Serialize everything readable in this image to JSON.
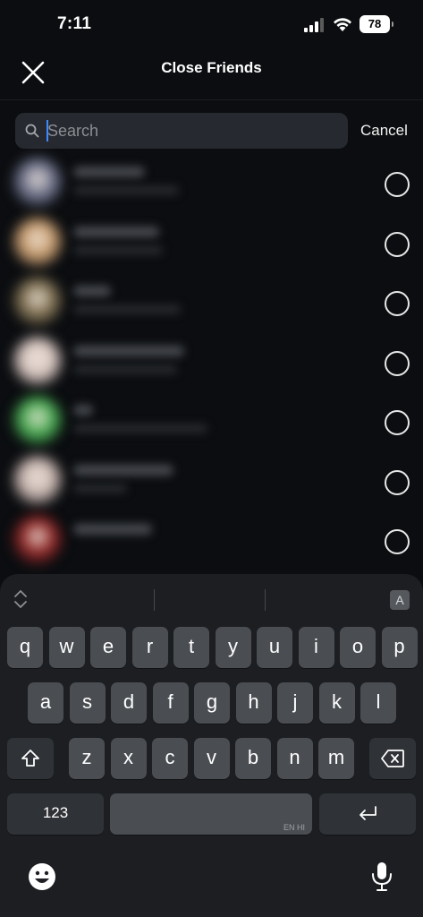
{
  "status": {
    "time": "7:11",
    "battery": "78"
  },
  "header": {
    "title": "Close Friends"
  },
  "search": {
    "placeholder": "Search",
    "cancel_label": "Cancel"
  },
  "friends": [
    {
      "avatar_color": "#6a6f8a",
      "selected": false
    },
    {
      "avatar_color": "#c79a6a",
      "selected": false
    },
    {
      "avatar_color": "#7a6a4a",
      "selected": false
    },
    {
      "avatar_color": "#d8c6c0",
      "selected": false
    },
    {
      "avatar_color": "#3fa84a",
      "selected": false
    },
    {
      "avatar_color": "#c9b6b0",
      "selected": false
    },
    {
      "avatar_color": "#8a1d1d",
      "selected": false
    }
  ],
  "keyboard": {
    "row1": [
      "q",
      "w",
      "e",
      "r",
      "t",
      "y",
      "u",
      "i",
      "o",
      "p"
    ],
    "row2": [
      "a",
      "s",
      "d",
      "f",
      "g",
      "h",
      "j",
      "k",
      "l"
    ],
    "row3": [
      "z",
      "x",
      "c",
      "v",
      "b",
      "n",
      "m"
    ],
    "numbers_label": "123",
    "space_hint": "EN HI",
    "lang_badge": "A"
  },
  "colors": {
    "accent_caret": "#3c8bff",
    "background": "#0b0d10",
    "key": "#4a4d52"
  }
}
